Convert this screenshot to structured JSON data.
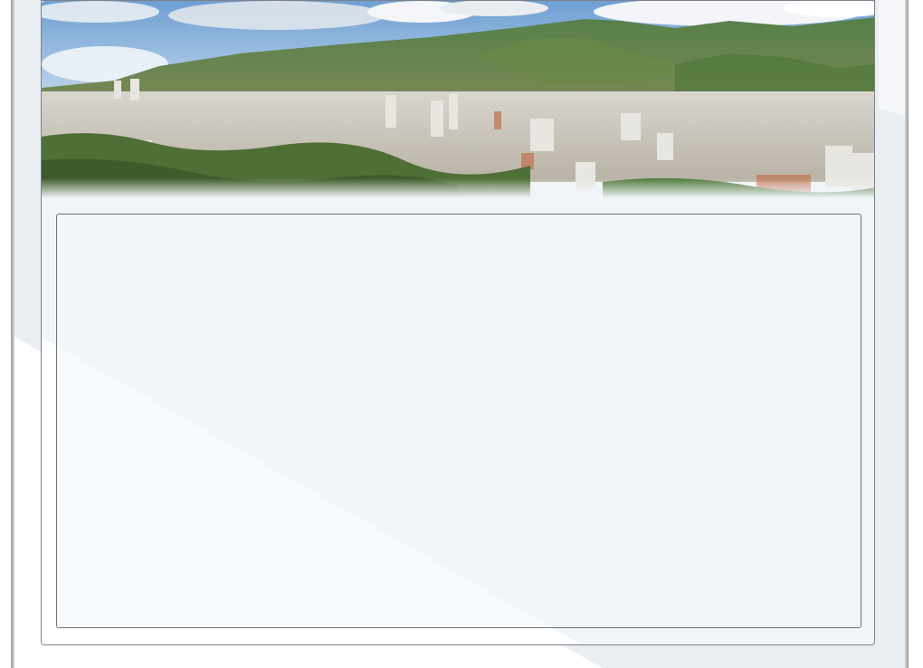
{
  "page": {
    "banner_image": "city-panorama-with-mountains",
    "colors": {
      "sky": "#8fb8e0",
      "mountain": "#4f7a3a",
      "panel_border": "#6f7278",
      "panel_background": "#f1f5f9",
      "page_background": "#e9eef3"
    }
  },
  "content_panel": {
    "text": ""
  }
}
